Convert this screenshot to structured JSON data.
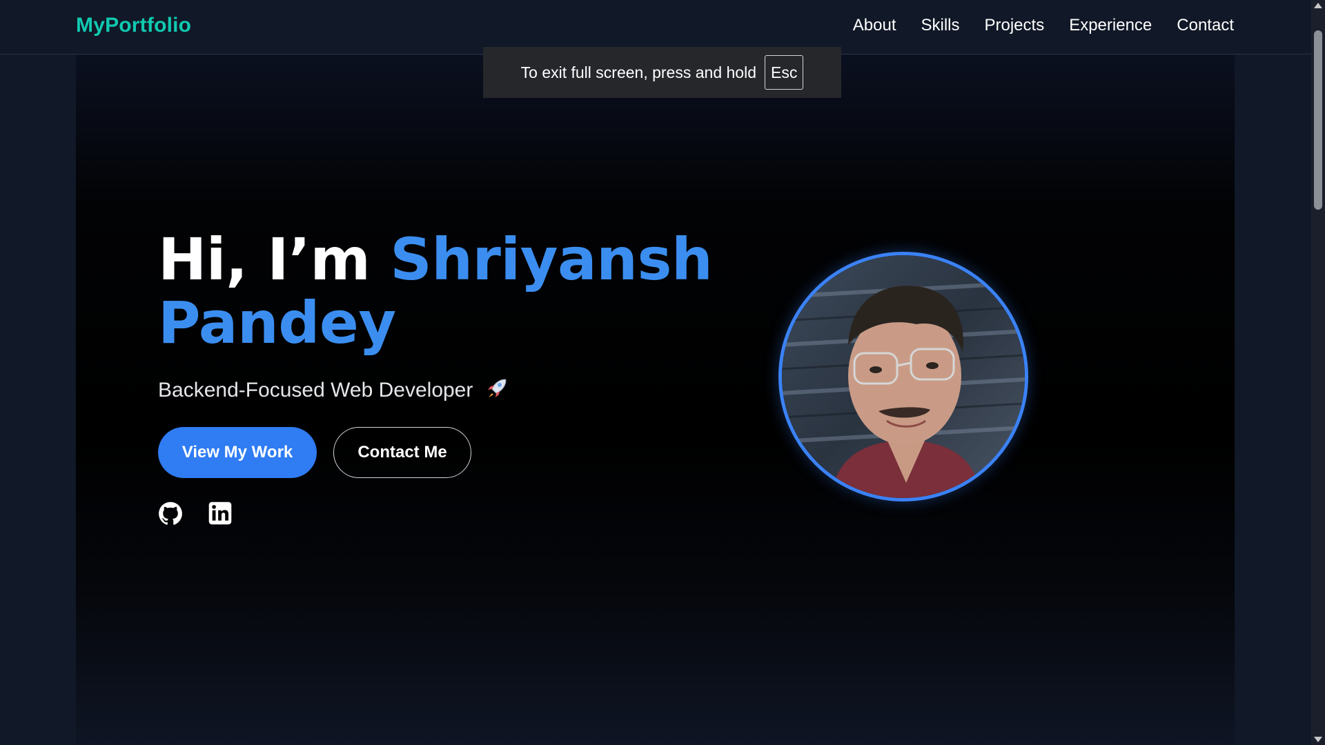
{
  "nav": {
    "brand": "MyPortfolio",
    "links": [
      "About",
      "Skills",
      "Projects",
      "Experience",
      "Contact"
    ]
  },
  "fullscreen_notice": {
    "message": "To exit full screen, press and hold",
    "key": "Esc"
  },
  "hero": {
    "greeting": "Hi, I’m",
    "name_first": "Shriyansh",
    "name_last": "Pandey",
    "subtitle": "Backend-Focused Web Developer",
    "subtitle_icon": "rocket-icon",
    "primary_button": "View My Work",
    "secondary_button": "Contact Me",
    "social_icons": [
      "github-icon",
      "linkedin-icon"
    ],
    "avatar_icon": "profile-photo"
  },
  "colors": {
    "brand": "#10c9b0",
    "accent": "#3b8ef0",
    "primary_button": "#2f7cf3",
    "avatar_border": "#3b82f6",
    "background": "#111827"
  }
}
